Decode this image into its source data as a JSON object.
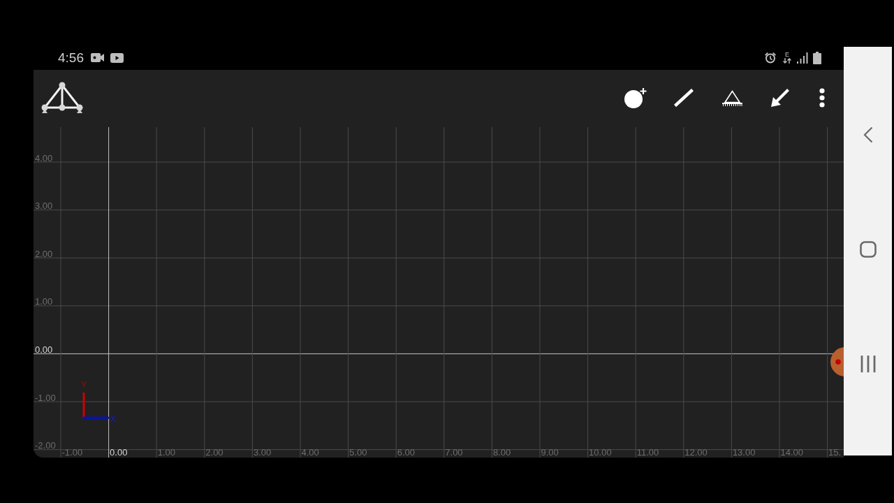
{
  "status_bar": {
    "time": "4:56",
    "network_type": "E"
  },
  "canvas": {
    "y_ticks": [
      {
        "label": "4.00",
        "axis": false
      },
      {
        "label": "3.00",
        "axis": false
      },
      {
        "label": "2.00",
        "axis": false
      },
      {
        "label": "1.00",
        "axis": false
      },
      {
        "label": "0.00",
        "axis": true
      },
      {
        "label": "-1.00",
        "axis": false
      },
      {
        "label": "-2.00",
        "axis": false
      }
    ],
    "x_ticks": [
      {
        "label": "-1.00",
        "axis": false
      },
      {
        "label": "0.00",
        "axis": true
      },
      {
        "label": "1.00",
        "axis": false
      },
      {
        "label": "2.00",
        "axis": false
      },
      {
        "label": "3.00",
        "axis": false
      },
      {
        "label": "4.00",
        "axis": false
      },
      {
        "label": "5.00",
        "axis": false
      },
      {
        "label": "6.00",
        "axis": false
      },
      {
        "label": "7.00",
        "axis": false
      },
      {
        "label": "8.00",
        "axis": false
      },
      {
        "label": "9.00",
        "axis": false
      },
      {
        "label": "10.00",
        "axis": false
      },
      {
        "label": "11.00",
        "axis": false
      },
      {
        "label": "12.00",
        "axis": false
      },
      {
        "label": "13.00",
        "axis": false
      },
      {
        "label": "14.00",
        "axis": false
      },
      {
        "label": "15.",
        "axis": false
      }
    ],
    "axis_indicator": {
      "y_letter": "Y",
      "x_letter": "X"
    }
  }
}
